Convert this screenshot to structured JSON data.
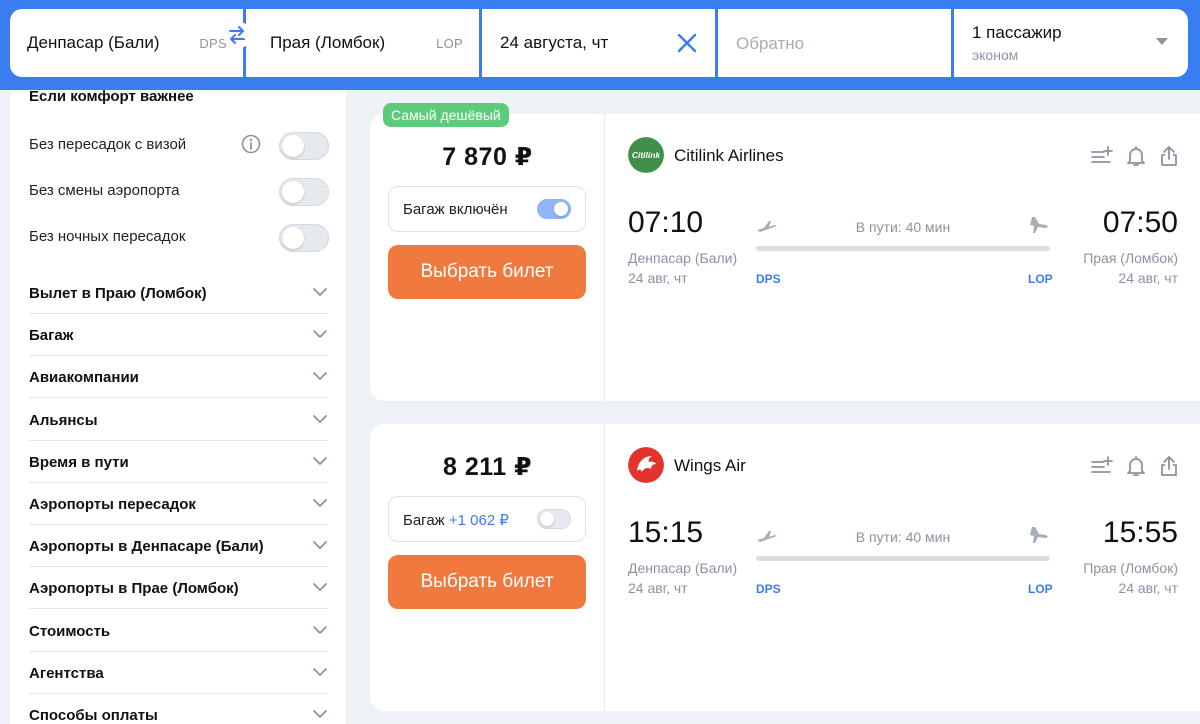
{
  "search": {
    "from_city": "Денпасар (Бали)",
    "from_iata": "DPS",
    "to_city": "Прая (Ломбок)",
    "to_iata": "LOP",
    "date": "24 августа, чт",
    "return_placeholder": "Обратно",
    "passengers": "1 пассажир",
    "cabin_class": "эконом"
  },
  "sidebar": {
    "title": "Если комфорт важнее",
    "toggles": [
      {
        "label": "Без пересадок с визой",
        "on": false
      },
      {
        "label": "Без смены аэропорта",
        "on": false
      },
      {
        "label": "Без ночных пересадок",
        "on": false
      }
    ],
    "sections": [
      "Вылет в Праю (Ломбок)",
      "Багаж",
      "Авиакомпании",
      "Альянсы",
      "Время в пути",
      "Аэропорты пересадок",
      "Аэропорты в Денпасаре (Бали)",
      "Аэропорты в Прае (Ломбок)",
      "Стоимость",
      "Агентства",
      "Способы оплаты"
    ]
  },
  "tickets": [
    {
      "badge": "Самый дешёвый",
      "price": "7 870 ₽",
      "baggage_label": "Багаж включён",
      "baggage_extra": "",
      "baggage_on": true,
      "select_label": "Выбрать билет",
      "airline": "Citilink Airlines",
      "logo_text": "Citilink",
      "logo_color": "#3f8f4a",
      "dep_time": "07:10",
      "arr_time": "07:50",
      "duration": "В пути: 40 мин",
      "dep_city": "Денпасар (Бали)",
      "arr_city": "Прая (Ломбок)",
      "dep_date": "24 авг, чт",
      "arr_date": "24 авг, чт",
      "dep_iata": "DPS",
      "arr_iata": "LOP"
    },
    {
      "badge": "",
      "price": "8 211 ₽",
      "baggage_label": "Багаж",
      "baggage_extra": "+1 062 ₽",
      "baggage_on": false,
      "select_label": "Выбрать билет",
      "airline": "Wings Air",
      "logo_text": "",
      "logo_color": "#e3332d",
      "dep_time": "15:15",
      "arr_time": "15:55",
      "duration": "В пути: 40 мин",
      "dep_city": "Денпасар (Бали)",
      "arr_city": "Прая (Ломбок)",
      "dep_date": "24 авг, чт",
      "arr_date": "24 авг, чт",
      "dep_iata": "DPS",
      "arr_iata": "LOP"
    }
  ],
  "colors": {
    "brand": "#3a7df0",
    "cta": "#f07a3e",
    "badge": "#5ccc7a"
  }
}
